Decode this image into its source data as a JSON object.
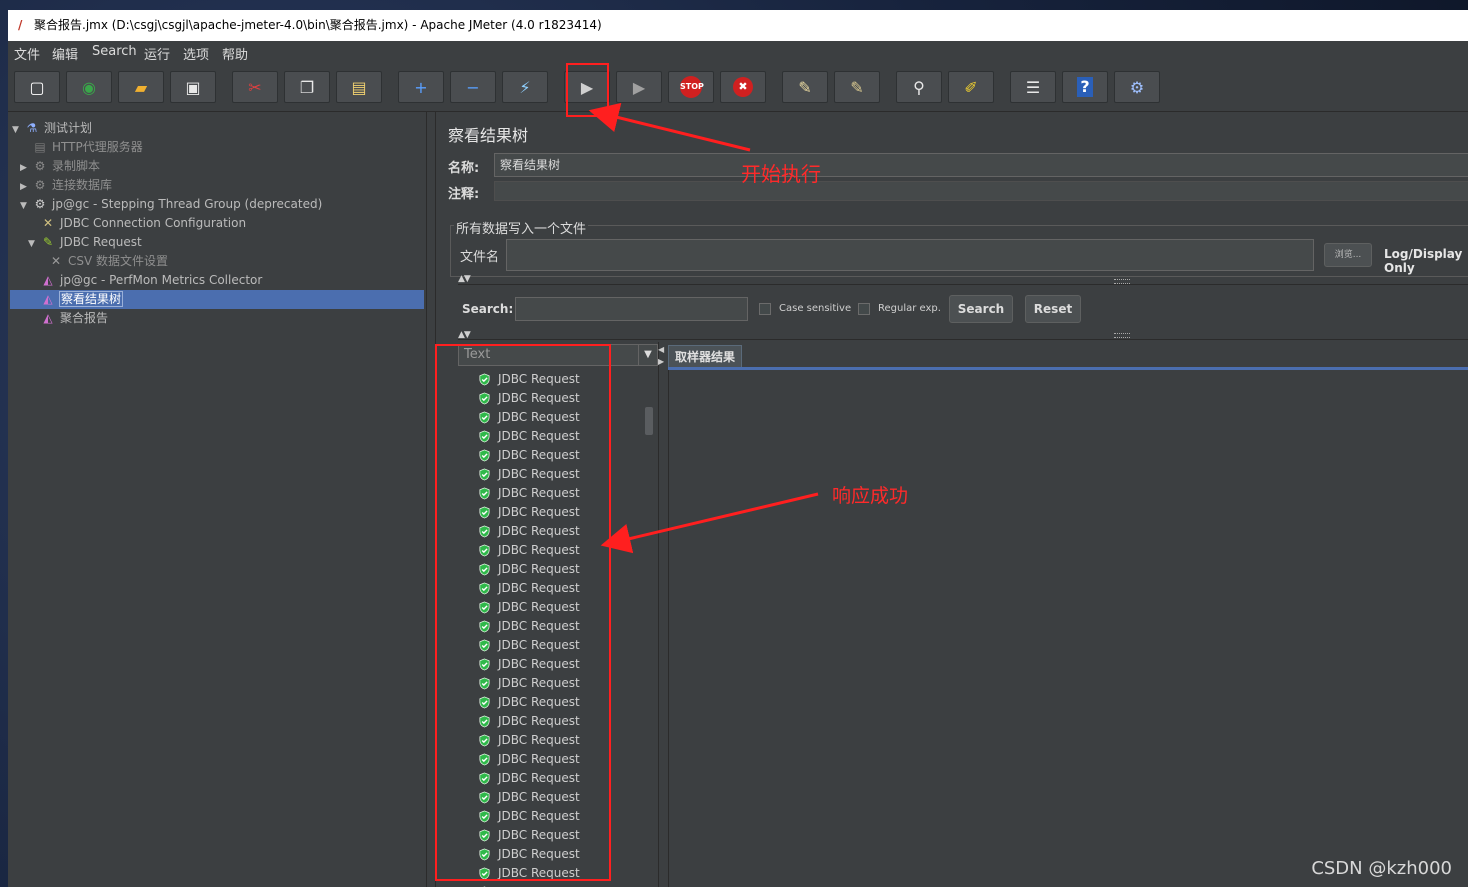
{
  "window": {
    "title": "聚合报告.jmx (D:\\csgj\\csgjl\\apache-jmeter-4.0\\bin\\聚合报告.jmx) - Apache JMeter (4.0 r1823414)"
  },
  "menu": [
    "文件",
    "编辑",
    "Search",
    "运行",
    "选项",
    "帮助"
  ],
  "toolbar": {
    "buttons": [
      {
        "name": "new-icon",
        "glyph": "▢",
        "color": "#ffffff"
      },
      {
        "name": "templates-icon",
        "glyph": "◉",
        "color": "#3aa64a"
      },
      {
        "name": "open-icon",
        "glyph": "▰",
        "color": "#f0b030"
      },
      {
        "name": "save-icon",
        "glyph": "▣",
        "color": "#e8e8e8"
      },
      {
        "name": "cut-icon",
        "glyph": "✂",
        "color": "#e04040"
      },
      {
        "name": "copy-icon",
        "glyph": "❐",
        "color": "#e8e8e8"
      },
      {
        "name": "paste-icon",
        "glyph": "▤",
        "color": "#f0d070"
      },
      {
        "name": "expand-icon",
        "glyph": "+",
        "color": "#5aa0ff"
      },
      {
        "name": "collapse-icon",
        "glyph": "−",
        "color": "#5aa0ff"
      },
      {
        "name": "toggle-icon",
        "glyph": "⚡",
        "color": "#8fd0ff"
      },
      {
        "name": "start-icon",
        "glyph": "▶",
        "color": "#d0d0d0"
      },
      {
        "name": "start-no-pause-icon",
        "glyph": "▶",
        "color": "#a0a0a0"
      },
      {
        "name": "stop-icon",
        "glyph": "STOP",
        "color": "#ffffff"
      },
      {
        "name": "shutdown-icon",
        "glyph": "✖",
        "color": "#ffffff"
      },
      {
        "name": "clear-icon",
        "glyph": "✎",
        "color": "#e8d8a0"
      },
      {
        "name": "clear-all-icon",
        "glyph": "✎",
        "color": "#d8c890"
      },
      {
        "name": "search-icon",
        "glyph": "⚲",
        "color": "#e8e8e8"
      },
      {
        "name": "reset-search-icon",
        "glyph": "✐",
        "color": "#f0d030"
      },
      {
        "name": "function-helper-icon",
        "glyph": "☰",
        "color": "#e8e8e8"
      },
      {
        "name": "help-icon",
        "glyph": "?",
        "color": "#ffffff"
      },
      {
        "name": "remote-icon",
        "glyph": "⚙",
        "color": "#9fc0ff"
      }
    ]
  },
  "tree": [
    {
      "label": "测试计划",
      "icon": "flask-icon",
      "glyph": "⚗",
      "iconColor": "#8fb0ff",
      "arrow": "▼",
      "indent": 0,
      "dim": false
    },
    {
      "label": "HTTP代理服务器",
      "icon": "proxy-icon",
      "glyph": "▤",
      "iconColor": "#7a7a7a",
      "arrow": "",
      "indent": 1,
      "dim": true
    },
    {
      "label": "录制脚本",
      "icon": "gear-icon",
      "glyph": "⚙",
      "iconColor": "#8a8a8a",
      "arrow": "▶",
      "indent": 1,
      "dim": true
    },
    {
      "label": "连接数据库",
      "icon": "gear-icon",
      "glyph": "⚙",
      "iconColor": "#8a8a8a",
      "arrow": "▶",
      "indent": 1,
      "dim": true
    },
    {
      "label": "jp@gc - Stepping Thread Group (deprecated)",
      "icon": "gear-icon",
      "glyph": "⚙",
      "iconColor": "#d0d0d0",
      "arrow": "▼",
      "indent": 1,
      "dim": false
    },
    {
      "label": "JDBC Connection Configuration",
      "icon": "wrench-icon",
      "glyph": "✕",
      "iconColor": "#d0c080",
      "arrow": "",
      "indent": 2,
      "dim": false
    },
    {
      "label": "JDBC Request",
      "icon": "pipette-icon",
      "glyph": "✎",
      "iconColor": "#9acd32",
      "arrow": "▼",
      "indent": 2,
      "dim": false
    },
    {
      "label": "CSV 数据文件设置",
      "icon": "wrench-icon",
      "glyph": "✕",
      "iconColor": "#9a9a9a",
      "arrow": "",
      "indent": 3,
      "dim": true
    },
    {
      "label": "jp@gc - PerfMon Metrics Collector",
      "icon": "graph-icon",
      "glyph": "◭",
      "iconColor": "#d070d0",
      "arrow": "",
      "indent": 2,
      "dim": false
    },
    {
      "label": "察看结果树",
      "icon": "graph-icon",
      "glyph": "◭",
      "iconColor": "#d070d0",
      "arrow": "",
      "indent": 2,
      "dim": false,
      "selected": true
    },
    {
      "label": "聚合报告",
      "icon": "graph-icon",
      "glyph": "◭",
      "iconColor": "#d070d0",
      "arrow": "",
      "indent": 2,
      "dim": false
    }
  ],
  "panel": {
    "title": "察看结果树",
    "name_label": "名称:",
    "name_value": "察看结果树",
    "comment_label": "注释:",
    "group_title": "所有数据写入一个文件",
    "filename_label": "文件名",
    "browse_label": "浏览...",
    "log_display_label": "Log/Display Only"
  },
  "search": {
    "label": "Search:",
    "case_sensitive": "Case sensitive",
    "regular_exp": "Regular exp.",
    "search_button": "Search",
    "reset_button": "Reset"
  },
  "results": {
    "renderer": "Text",
    "tab": "取样器结果",
    "row_label": "JDBC Request",
    "row_count": 28
  },
  "annotations": {
    "start_text": "开始执行",
    "success_text": "响应成功"
  },
  "watermark": "CSDN @kzh000"
}
